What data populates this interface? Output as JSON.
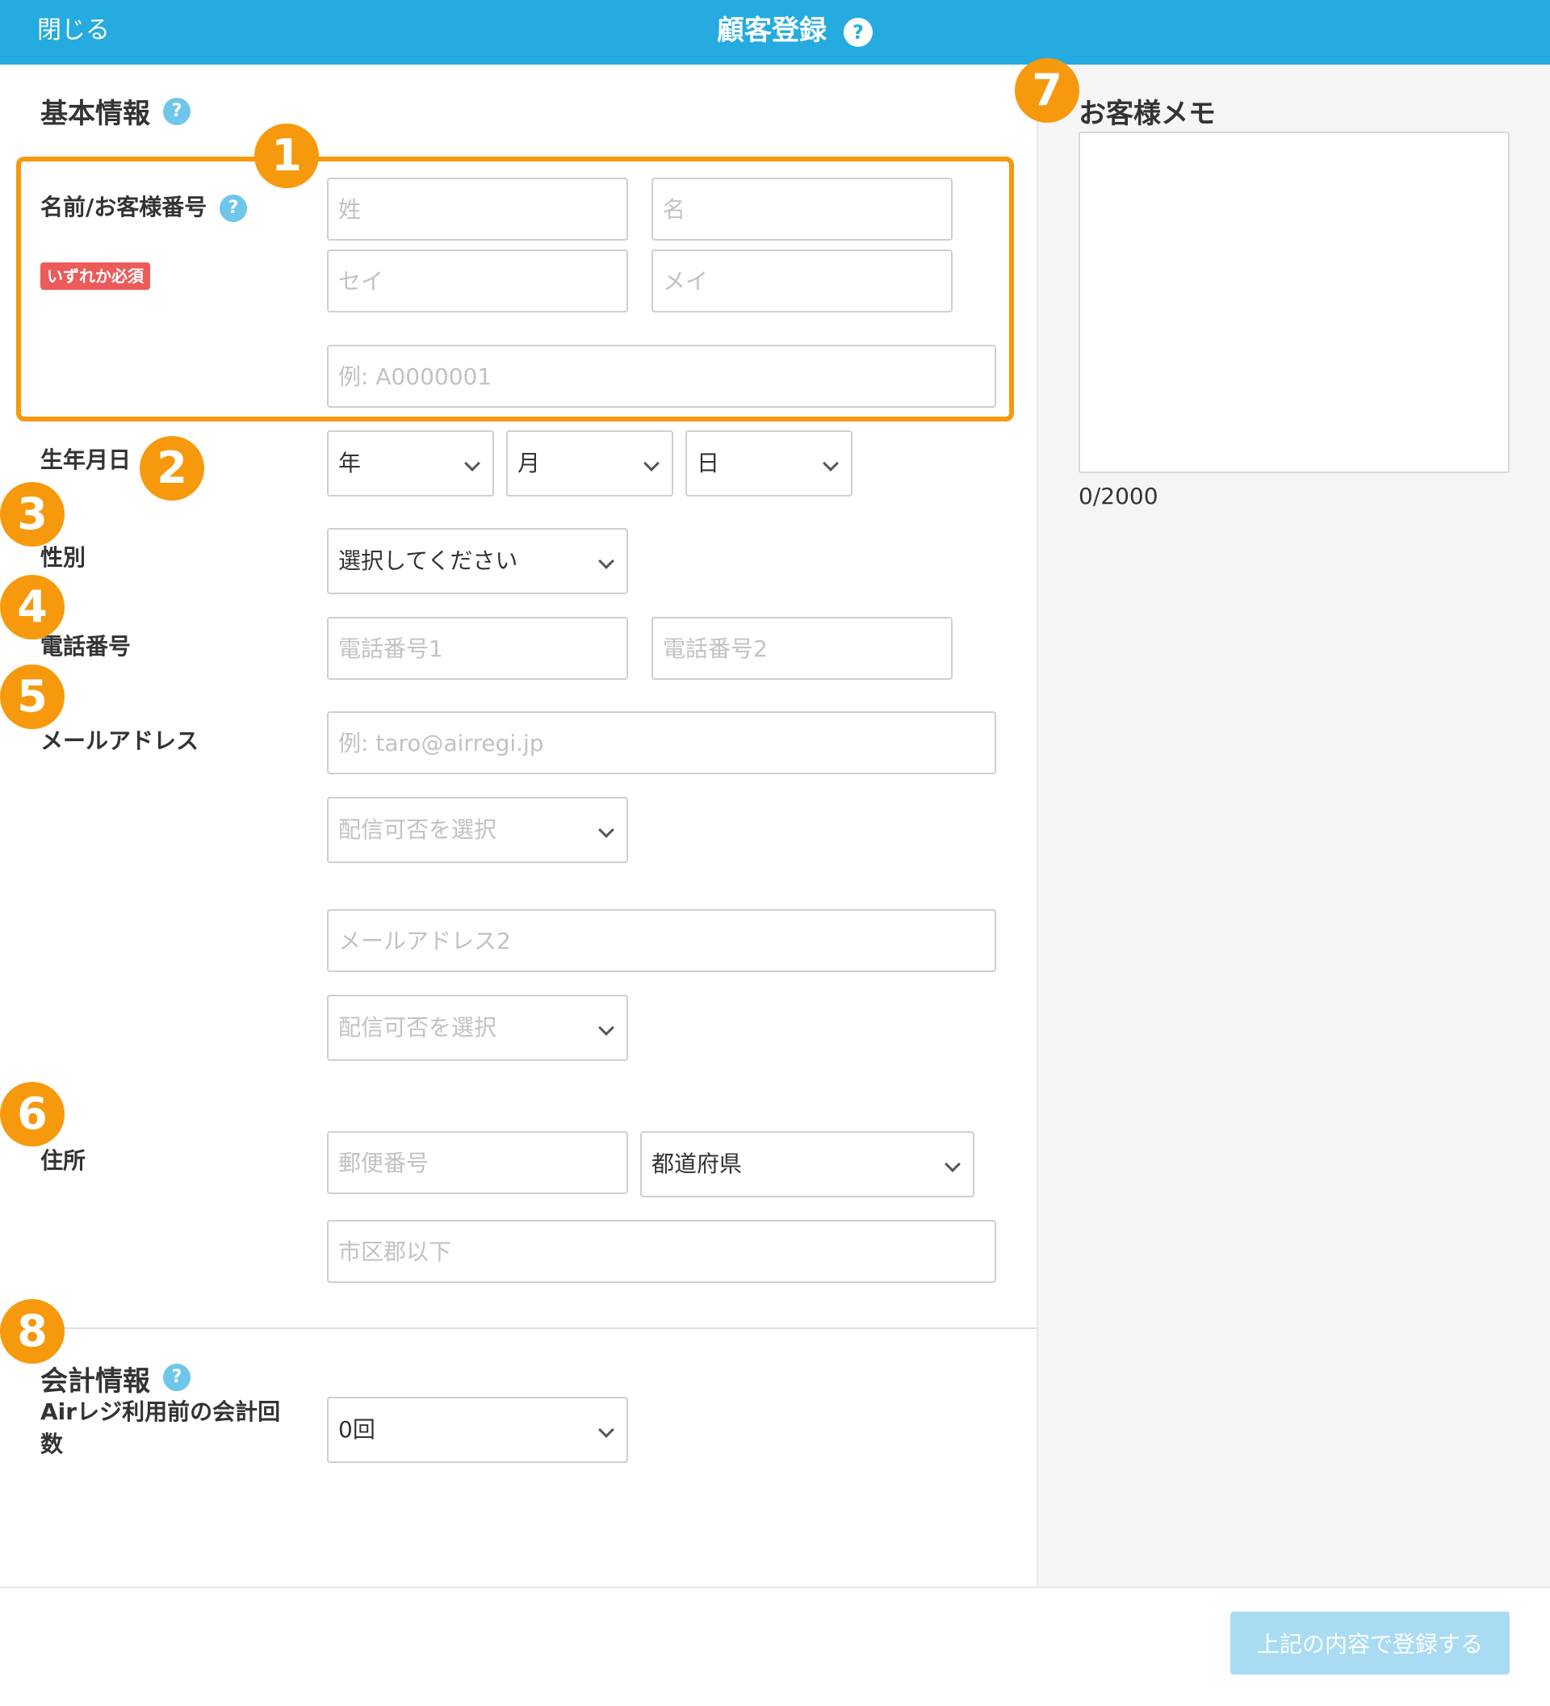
{
  "header": {
    "close_label": "閉じる",
    "title": "顧客登録",
    "help": "?"
  },
  "basic": {
    "title": "基本情報",
    "help": "?",
    "name": {
      "label": "名前/お客様番号",
      "help": "?",
      "required_badge": "いずれか必須",
      "last_name_placeholder": "姓",
      "first_name_placeholder": "名",
      "last_kana_placeholder": "セイ",
      "first_kana_placeholder": "メイ",
      "customer_no_placeholder": "例: A0000001"
    },
    "birthday": {
      "label": "生年月日",
      "year": "年",
      "month": "月",
      "day": "日"
    },
    "gender": {
      "label": "性別",
      "value": "選択してください"
    },
    "phone": {
      "label": "電話番号",
      "phone1_placeholder": "電話番号1",
      "phone2_placeholder": "電話番号2"
    },
    "email": {
      "label": "メールアドレス",
      "email1_placeholder": "例: taro@airregi.jp",
      "delivery1": "配信可否を選択",
      "email2_placeholder": "メールアドレス2",
      "delivery2": "配信可否を選択"
    },
    "address": {
      "label": "住所",
      "postal_placeholder": "郵便番号",
      "prefecture": "都道府県",
      "city_placeholder": "市区郡以下"
    }
  },
  "accounting": {
    "title": "会計情報",
    "help": "?",
    "count_label_line1": "Airレジ利用前の会計回",
    "count_label_line2": "数",
    "count_value": "0回"
  },
  "memo": {
    "title": "お客様メモ",
    "counter": "0/2000"
  },
  "footer": {
    "submit_label": "上記の内容で登録する"
  },
  "markers": [
    "1",
    "2",
    "3",
    "4",
    "5",
    "6",
    "7",
    "8"
  ],
  "colors": {
    "header": "#25abe0",
    "marker": "#f7990d",
    "required": "#ec5a5a",
    "submit_disabled": "#a9dcf2"
  }
}
